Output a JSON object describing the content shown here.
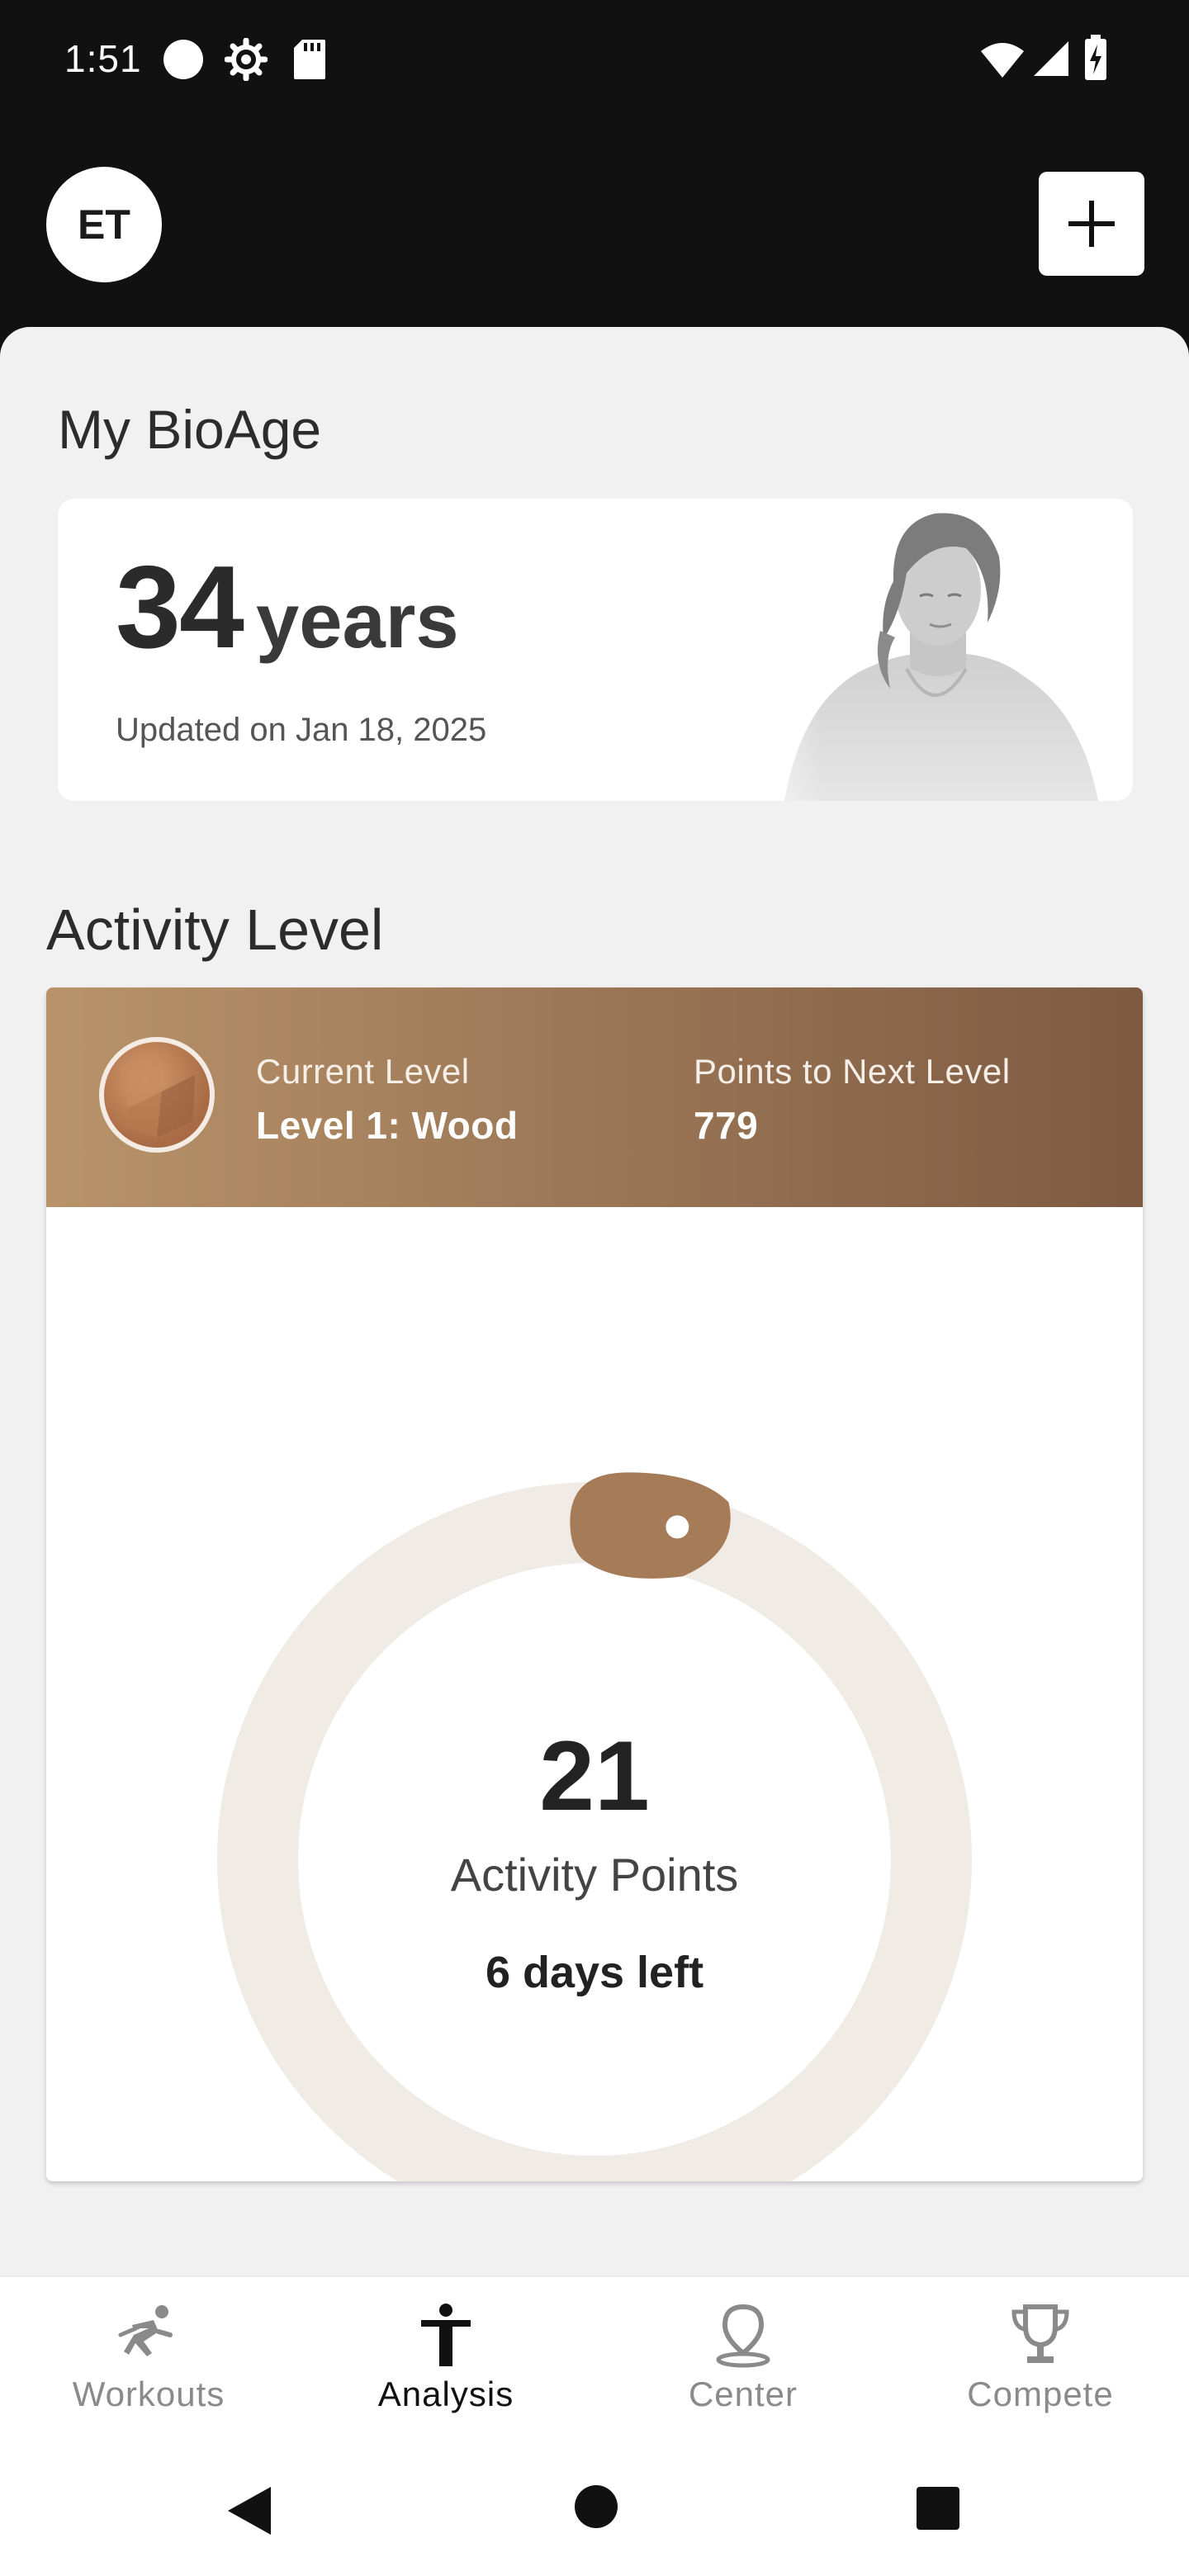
{
  "status_bar": {
    "time": "1:51",
    "icons": [
      "circle-icon",
      "settings-gear-icon",
      "sd-card-icon",
      "wifi-icon",
      "cell-signal-icon",
      "battery-charging-icon"
    ]
  },
  "header": {
    "avatar_initials": "ET",
    "add_icon": "plus-icon"
  },
  "bioage": {
    "title": "My BioAge",
    "value": "34",
    "unit": "years",
    "updated": "Updated on Jan 18, 2025"
  },
  "activity": {
    "title": "Activity Level",
    "current_level_label": "Current Level",
    "current_level_value": "Level 1: Wood",
    "next_level_label": "Points to Next Level",
    "next_level_value": "779",
    "points": "21",
    "points_label": "Activity Points",
    "days_left": "6 days left",
    "progress_fraction": 0.026,
    "colors": {
      "ring_track": "#f1ebe5",
      "ring_marker": "#a57b58",
      "banner_start": "#b8936a",
      "banner_end": "#7e5a42"
    }
  },
  "bottom_nav": {
    "items": [
      {
        "label": "Workouts",
        "icon": "running-icon",
        "active": false
      },
      {
        "label": "Analysis",
        "icon": "person-icon",
        "active": true
      },
      {
        "label": "Center",
        "icon": "location-pin-icon",
        "active": false
      },
      {
        "label": "Compete",
        "icon": "trophy-icon",
        "active": false
      }
    ]
  },
  "system_nav": {
    "icons": [
      "back-icon",
      "home-icon",
      "recents-icon"
    ]
  }
}
